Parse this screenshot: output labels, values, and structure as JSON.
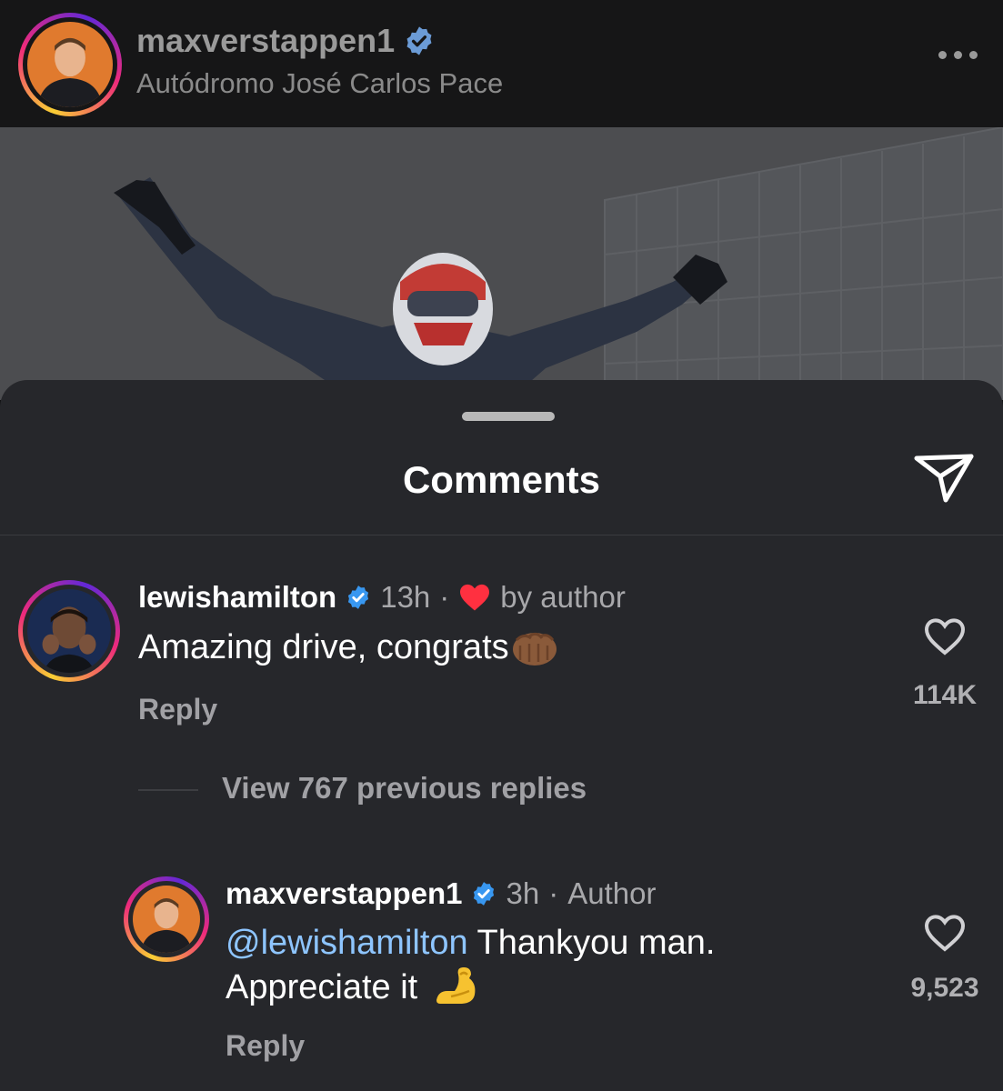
{
  "post": {
    "username": "maxverstappen1",
    "location": "Autódromo José Carlos Pace",
    "avatar_icon": "driver-avatar",
    "verified_icon": "verified-badge-icon",
    "more_icon": "more-options-icon"
  },
  "comments_sheet": {
    "title": "Comments",
    "share_icon": "send-icon",
    "accent_blue": "#3897f0",
    "like_red": "#ff3040"
  },
  "comments": [
    {
      "username": "lewishamilton",
      "time": "13h",
      "separator": "·",
      "liked_by_author": "by author",
      "text": "Amazing drive, congrats",
      "emoji": "fist-bump-emoji",
      "reply_label": "Reply",
      "like_count": "114K"
    }
  ],
  "view_replies": "View 767 previous replies",
  "replies": [
    {
      "username": "maxverstappen1",
      "time": "3h",
      "separator": "·",
      "author_label": "Author",
      "mention": "@lewishamilton",
      "text_line1": " Thankyou man.",
      "text_line2": "Appreciate it",
      "emoji": "flexed-biceps-emoji",
      "reply_label": "Reply",
      "like_count": "9,523"
    }
  ]
}
